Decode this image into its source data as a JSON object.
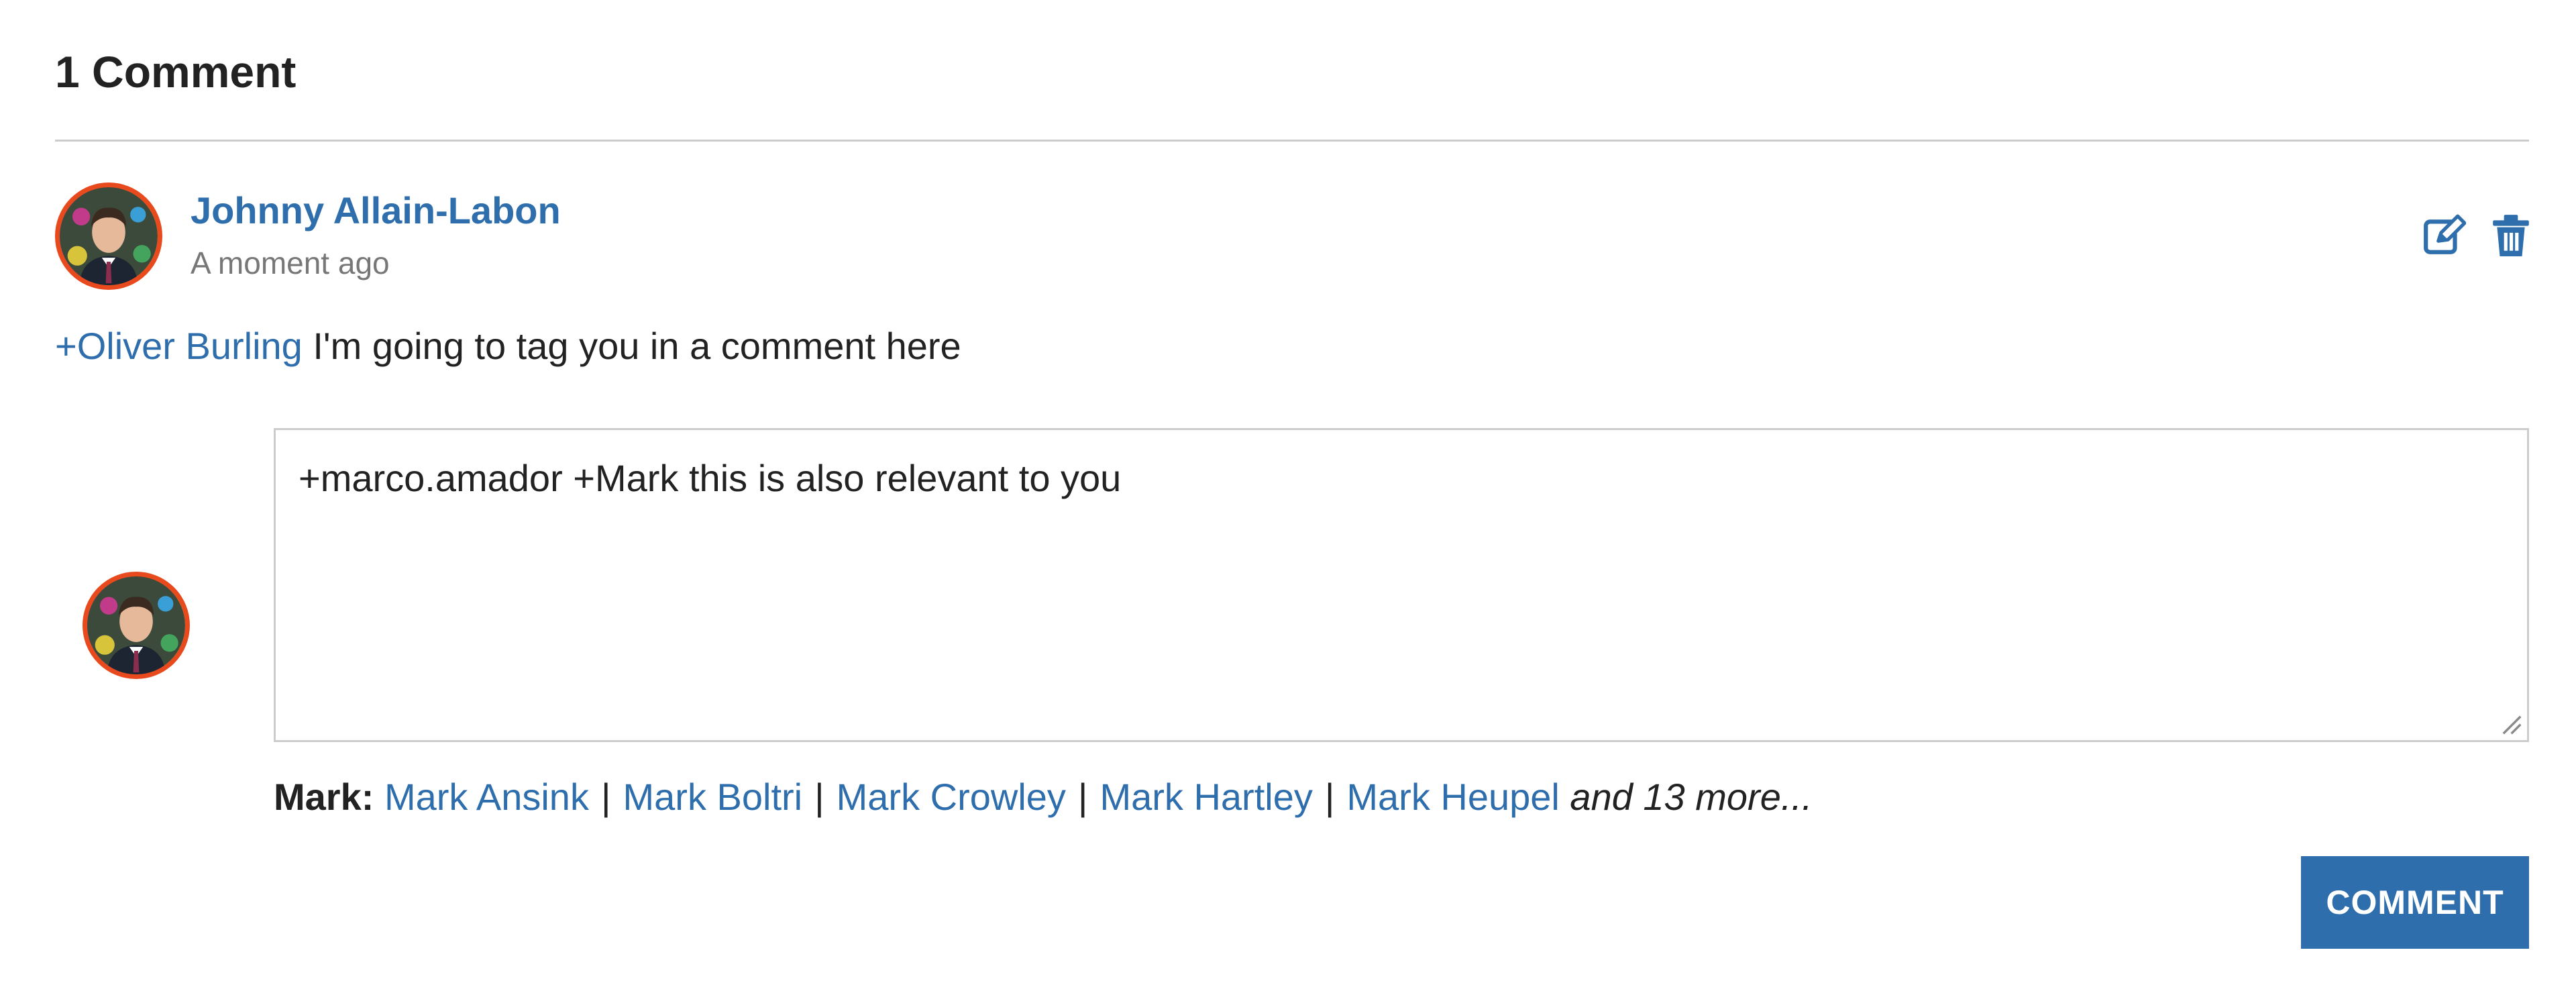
{
  "heading": "1 Comment",
  "comment": {
    "author": "Johnny Allain-Labon",
    "timestamp": "A moment ago",
    "mention": "+Oliver Burling",
    "text": " I'm going to tag you in a comment here"
  },
  "icons": {
    "edit": "edit-icon",
    "delete": "trash-icon",
    "avatar": "user-avatar"
  },
  "reply": {
    "value": "+marco.amador +Mark this is also relevant to you"
  },
  "suggestions": {
    "label": "Mark:",
    "names": [
      "Mark Ansink",
      "Mark Boltri",
      "Mark Crowley",
      "Mark Hartley",
      "Mark Heupel"
    ],
    "separator": "|",
    "more": "and 13 more..."
  },
  "submit_label": "COMMENT",
  "colors": {
    "link": "#2f6eac",
    "button": "#2f6eac",
    "divider": "#cccccc"
  }
}
